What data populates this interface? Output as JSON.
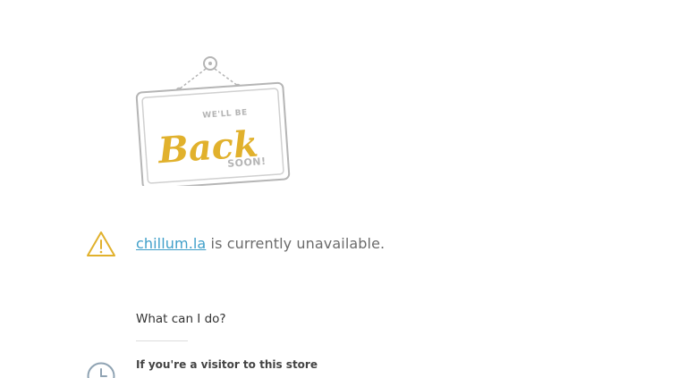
{
  "sign": {
    "line1": "WE'LL BE",
    "line2": "Back",
    "line3": "SOON!"
  },
  "status": {
    "domain_link": "chillum.la",
    "message": " is currently unavailable."
  },
  "help": {
    "title": "What can I do?",
    "visitor_title": "If you're a visitor to this store"
  },
  "colors": {
    "accent_gold": "#e1b12c",
    "link_blue": "#3f9fc9",
    "sign_gray": "#b5b5b5"
  },
  "icons": {
    "warning": "warning-triangle-icon",
    "clock": "clock-icon"
  }
}
